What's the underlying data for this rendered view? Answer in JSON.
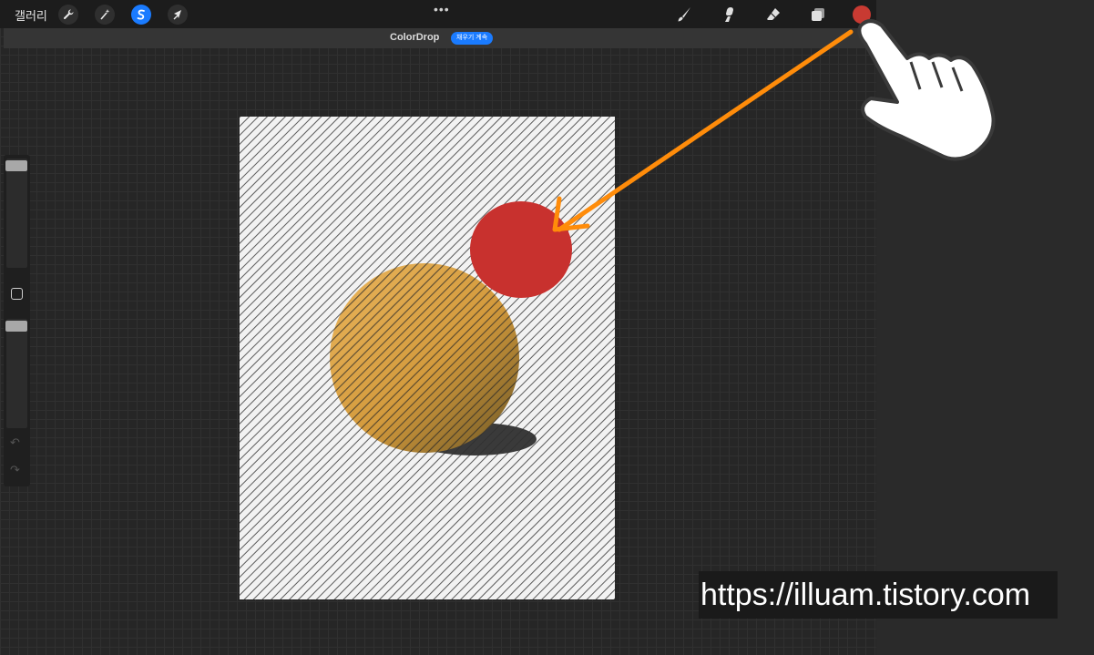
{
  "topbar": {
    "gallery_label": "갤러리",
    "left_tools": [
      {
        "name": "actions",
        "icon": "wrench-icon"
      },
      {
        "name": "adjustments",
        "icon": "magic-wand-icon"
      },
      {
        "name": "selection",
        "icon": "selection-s-icon",
        "active": true
      },
      {
        "name": "transform",
        "icon": "arrow-cursor-icon"
      }
    ],
    "center_dots": "•••",
    "right_tools": [
      {
        "name": "brush",
        "icon": "brush-icon"
      },
      {
        "name": "smudge",
        "icon": "smudge-icon"
      },
      {
        "name": "eraser",
        "icon": "eraser-icon"
      },
      {
        "name": "layers",
        "icon": "layers-icon"
      }
    ],
    "current_color": "#c83a32"
  },
  "subbar": {
    "title": "ColorDrop",
    "badge": "채우기 계속"
  },
  "sidebar": {
    "undo_label": "↶",
    "redo_label": "↷"
  },
  "canvas": {
    "background": "#f2f2f2",
    "shapes": [
      {
        "name": "red-circle",
        "color": "#c8312e"
      },
      {
        "name": "yellow-sphere",
        "color": "#d9a040"
      },
      {
        "name": "shadow",
        "color": "#3a3a3a"
      }
    ]
  },
  "annotation": {
    "arrow_color": "#ff8c0a",
    "hand_icon": "pointing-hand-icon"
  },
  "watermark": {
    "text": "https://illuam.tistory.com"
  }
}
